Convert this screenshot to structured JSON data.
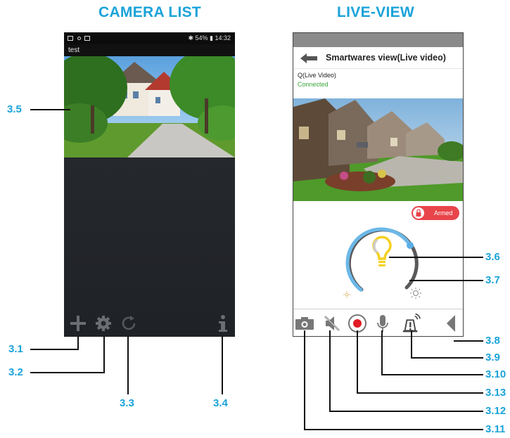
{
  "headings": {
    "camera_list": "CAMERA LIST",
    "live_view": "LIVE-VIEW"
  },
  "camera_list": {
    "status_bar": {
      "right_text": "54% ▮ 14:32",
      "icons": [
        "image-icon",
        "dot-icon",
        "mail-icon",
        "bluetooth-icon",
        "vibrate-icon",
        "signal-icon",
        "battery-icon"
      ]
    },
    "camera_name": "test",
    "toolbar_icons": [
      "plus-icon",
      "gear-icon",
      "refresh-icon",
      "info-icon"
    ]
  },
  "live_view": {
    "title": "Smartwares view(Live video)",
    "camera_name": "Q(Live Video)",
    "connection_status": "Connected",
    "armed_label": "Armed",
    "light_level": 0.7,
    "toolbar_icons": [
      "camera-icon",
      "mute-icon",
      "record-icon",
      "microphone-icon",
      "siren-icon",
      "collapse-arrow-icon"
    ]
  },
  "callouts": {
    "c3_1": "3.1",
    "c3_2": "3.2",
    "c3_3": "3.3",
    "c3_4": "3.4",
    "c3_5": "3.5",
    "c3_6": "3.6",
    "c3_7": "3.7",
    "c3_8": "3.8",
    "c3_9": "3.9",
    "c3_10": "3.10",
    "c3_11": "3.11",
    "c3_12": "3.12",
    "c3_13": "3.13"
  },
  "colors": {
    "accent": "#1aa3d9",
    "armed": "#e8454a",
    "connected": "#3aa83a",
    "dial": "#6cb8e8",
    "bulb": "#f5d020"
  }
}
